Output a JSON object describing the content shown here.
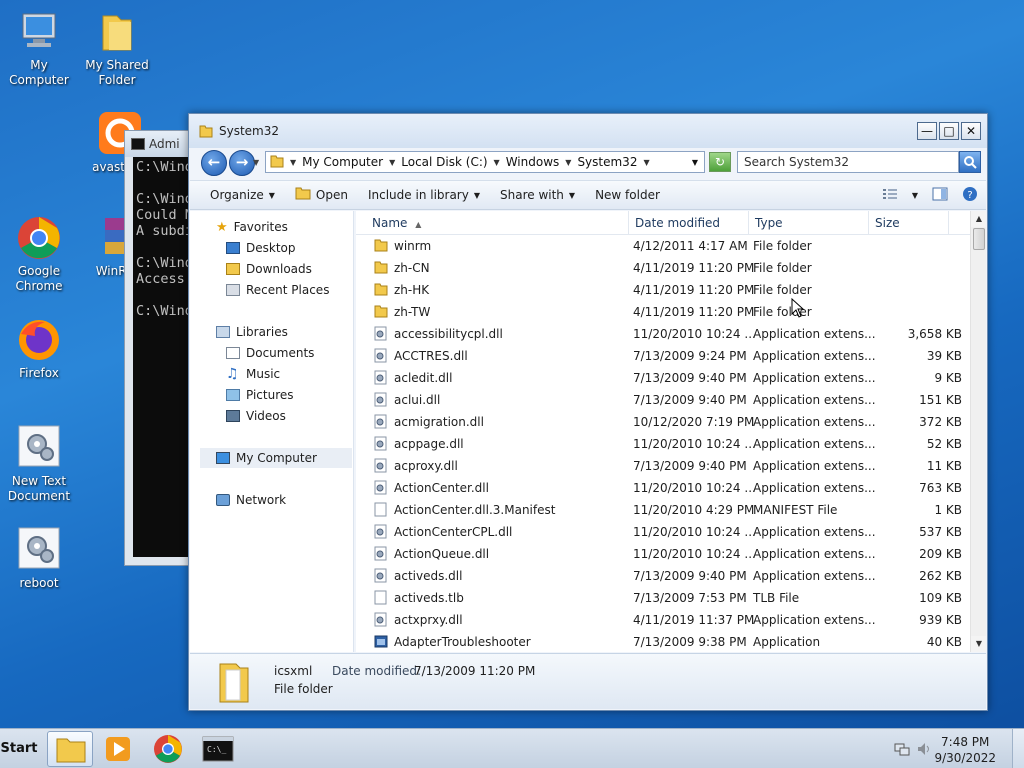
{
  "desktop": {
    "icons": [
      {
        "label_line1": "My Computer",
        "label_line2": ""
      },
      {
        "label_line1": "My Shared",
        "label_line2": "Folder"
      },
      {
        "label_line1": "avast_on",
        "label_line2": ""
      },
      {
        "label_line1": "Google",
        "label_line2": "Chrome"
      },
      {
        "label_line1": "WinRA",
        "label_line2": ""
      },
      {
        "label_line1": "Firefox",
        "label_line2": ""
      },
      {
        "label_line1": "New Text",
        "label_line2": "Document"
      },
      {
        "label_line1": "reboot",
        "label_line2": ""
      }
    ]
  },
  "cmd": {
    "title": "Admi",
    "lines": "C:\\Wind\n\nC:\\Wind\nCould N\nA subdi\n\nC:\\Wind\nAccess \n\nC:\\Wind"
  },
  "explorer": {
    "title": "System32",
    "breadcrumb": [
      "My Computer",
      "Local Disk (C:)",
      "Windows",
      "System32"
    ],
    "search_placeholder": "Search System32",
    "toolbar": {
      "organize": "Organize",
      "open": "Open",
      "include": "Include in library",
      "share": "Share with",
      "new_folder": "New folder"
    },
    "nav": {
      "favorites": "Favorites",
      "desktop": "Desktop",
      "downloads": "Downloads",
      "recent": "Recent Places",
      "libraries": "Libraries",
      "documents": "Documents",
      "music": "Music",
      "pictures": "Pictures",
      "videos": "Videos",
      "computer": "My Computer",
      "network": "Network"
    },
    "columns": {
      "name": "Name",
      "date": "Date modified",
      "type": "Type",
      "size": "Size"
    },
    "files": [
      {
        "name": "winrm",
        "date": "4/12/2011 4:17 AM",
        "type": "File folder",
        "size": "",
        "kind": "folder"
      },
      {
        "name": "zh-CN",
        "date": "4/11/2019 11:20 PM",
        "type": "File folder",
        "size": "",
        "kind": "folder"
      },
      {
        "name": "zh-HK",
        "date": "4/11/2019 11:20 PM",
        "type": "File folder",
        "size": "",
        "kind": "folder"
      },
      {
        "name": "zh-TW",
        "date": "4/11/2019 11:20 PM",
        "type": "File folder",
        "size": "",
        "kind": "folder"
      },
      {
        "name": "accessibilitycpl.dll",
        "date": "11/20/2010 10:24 ...",
        "type": "Application extens...",
        "size": "3,658 KB",
        "kind": "dll"
      },
      {
        "name": "ACCTRES.dll",
        "date": "7/13/2009 9:24 PM",
        "type": "Application extens...",
        "size": "39 KB",
        "kind": "dll"
      },
      {
        "name": "acledit.dll",
        "date": "7/13/2009 9:40 PM",
        "type": "Application extens...",
        "size": "9 KB",
        "kind": "dll"
      },
      {
        "name": "aclui.dll",
        "date": "7/13/2009 9:40 PM",
        "type": "Application extens...",
        "size": "151 KB",
        "kind": "dll"
      },
      {
        "name": "acmigration.dll",
        "date": "10/12/2020 7:19 PM",
        "type": "Application extens...",
        "size": "372 KB",
        "kind": "dll"
      },
      {
        "name": "acppage.dll",
        "date": "11/20/2010 10:24 ...",
        "type": "Application extens...",
        "size": "52 KB",
        "kind": "dll"
      },
      {
        "name": "acproxy.dll",
        "date": "7/13/2009 9:40 PM",
        "type": "Application extens...",
        "size": "11 KB",
        "kind": "dll"
      },
      {
        "name": "ActionCenter.dll",
        "date": "11/20/2010 10:24 ...",
        "type": "Application extens...",
        "size": "763 KB",
        "kind": "dll"
      },
      {
        "name": "ActionCenter.dll.3.Manifest",
        "date": "11/20/2010 4:29 PM",
        "type": "MANIFEST File",
        "size": "1 KB",
        "kind": "file"
      },
      {
        "name": "ActionCenterCPL.dll",
        "date": "11/20/2010 10:24 ...",
        "type": "Application extens...",
        "size": "537 KB",
        "kind": "dll"
      },
      {
        "name": "ActionQueue.dll",
        "date": "11/20/2010 10:24 ...",
        "type": "Application extens...",
        "size": "209 KB",
        "kind": "dll"
      },
      {
        "name": "activeds.dll",
        "date": "7/13/2009 9:40 PM",
        "type": "Application extens...",
        "size": "262 KB",
        "kind": "dll"
      },
      {
        "name": "activeds.tlb",
        "date": "7/13/2009 7:53 PM",
        "type": "TLB File",
        "size": "109 KB",
        "kind": "file"
      },
      {
        "name": "actxprxy.dll",
        "date": "4/11/2019 11:37 PM",
        "type": "Application extens...",
        "size": "939 KB",
        "kind": "dll"
      },
      {
        "name": "AdapterTroubleshooter",
        "date": "7/13/2009 9:38 PM",
        "type": "Application",
        "size": "40 KB",
        "kind": "app"
      }
    ],
    "details": {
      "name": "icsxml",
      "date_label": "Date modified:",
      "date_value": "7/13/2009 11:20 PM",
      "type": "File folder"
    }
  },
  "taskbar": {
    "start": "Start",
    "time": "7:48 PM",
    "date": "9/30/2022"
  },
  "colors": {
    "folder": "#f2c94c",
    "accent": "#1e5bb2"
  }
}
